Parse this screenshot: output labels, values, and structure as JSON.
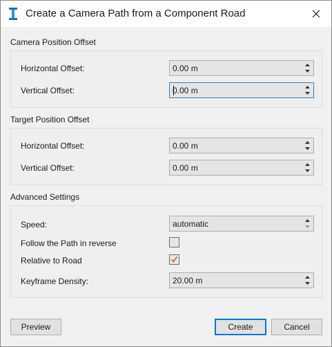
{
  "window": {
    "title": "Create a Camera Path from a Component Road"
  },
  "camera_position_offset": {
    "title": "Camera Position Offset",
    "horizontal_label": "Horizontal Offset:",
    "horizontal_value": "0.00 m",
    "vertical_label": "Vertical Offset:",
    "vertical_value": "0.00 m"
  },
  "target_position_offset": {
    "title": "Target Position Offset",
    "horizontal_label": "Horizontal Offset:",
    "horizontal_value": "0.00 m",
    "vertical_label": "Vertical Offset:",
    "vertical_value": "0.00 m"
  },
  "advanced_settings": {
    "title": "Advanced Settings",
    "speed_label": "Speed:",
    "speed_value": "automatic",
    "reverse_label": "Follow the Path in reverse",
    "reverse_checked": false,
    "relative_label": "Relative to Road",
    "relative_checked": true,
    "density_label": "Keyframe Density:",
    "density_value": "20.00 m"
  },
  "buttons": {
    "preview": "Preview",
    "create": "Create",
    "cancel": "Cancel"
  },
  "colors": {
    "check_mark": "#d25a1e",
    "focus_border": "#3c7fb1",
    "default_button_border": "#0078d7"
  },
  "icons": {
    "app": "app-logo-icon",
    "close": "close-icon",
    "spin_up": "chevron-up-icon",
    "spin_down": "chevron-down-icon",
    "check": "checkmark-icon"
  }
}
